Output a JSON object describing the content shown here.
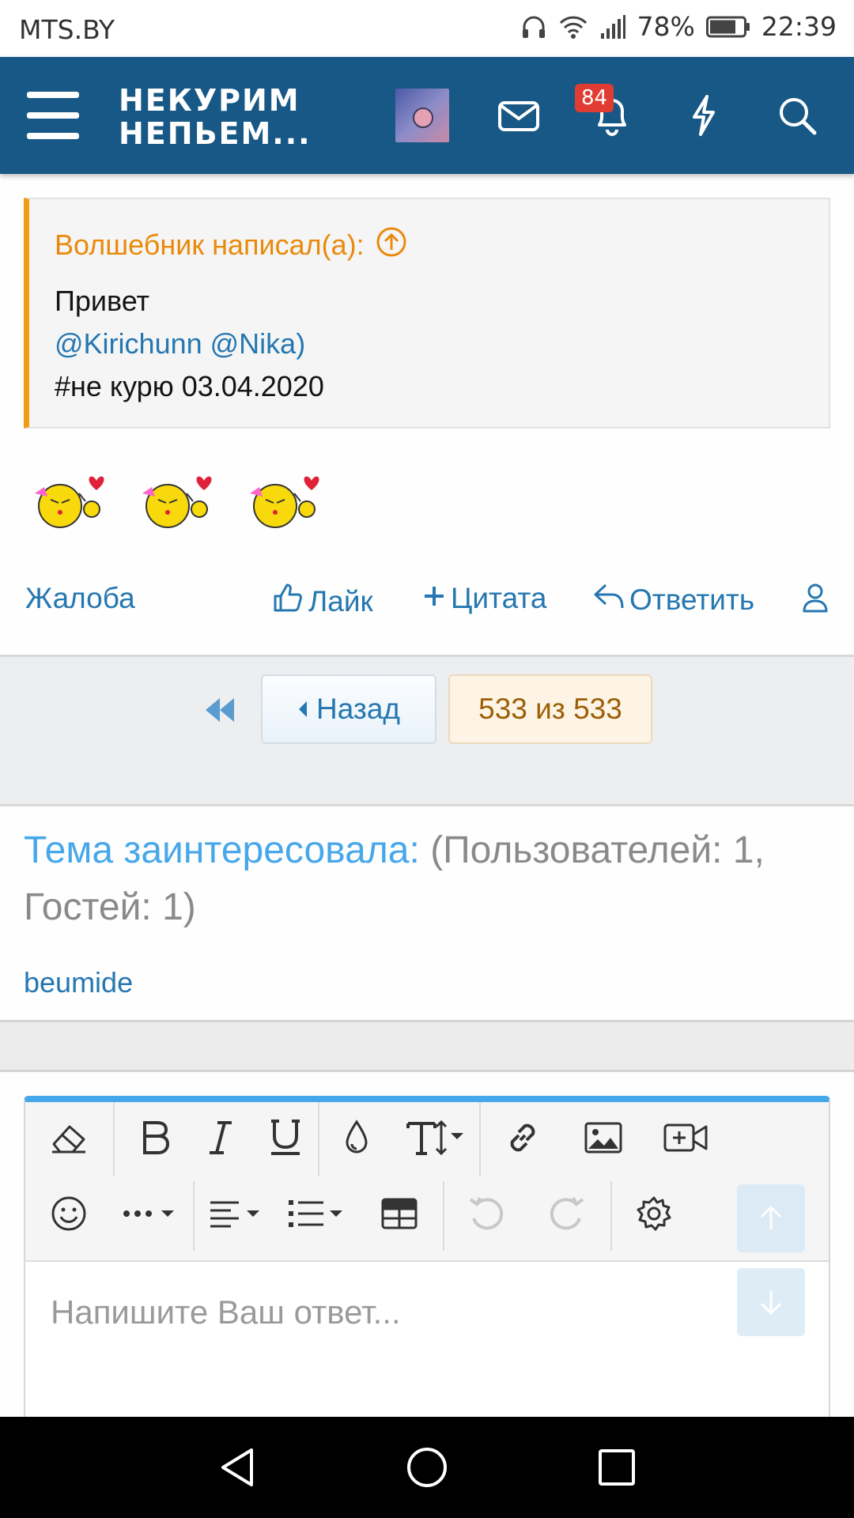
{
  "status_bar": {
    "carrier": "MTS.BY",
    "battery_percent": "78%",
    "time": "22:39"
  },
  "header": {
    "logo_line1": "НЕКУРИМ",
    "logo_line2": "НЕПЬЕМ...",
    "notification_count": "84",
    "brand_color": "#185886"
  },
  "quote": {
    "author_line": "Волшебник написал(а):",
    "line1": "Привет",
    "mentions": "@Kirichunn @Nika)",
    "line3": "#не курю 03.04.2020"
  },
  "post_actions": {
    "report": "Жалоба",
    "like": "Лайк",
    "quote": "Цитата",
    "reply": "Ответить"
  },
  "pagination": {
    "back": "Назад",
    "current": "533 из 533"
  },
  "interested": {
    "label": "Тема заинтересовала:",
    "counts": "(Пользователей: 1, Гостей: 1)",
    "users": [
      "beumide"
    ]
  },
  "editor": {
    "placeholder": "Напишите Ваш ответ..."
  }
}
